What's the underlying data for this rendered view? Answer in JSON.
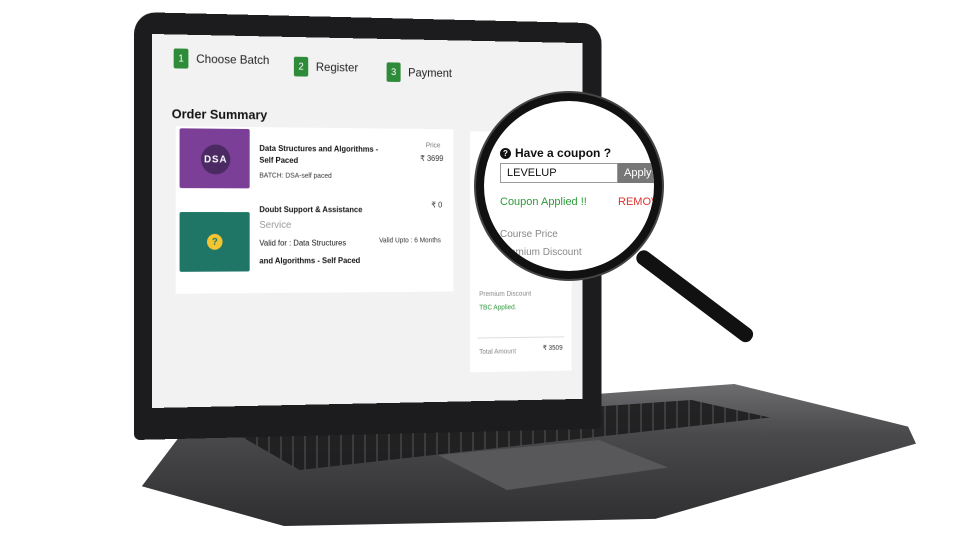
{
  "steps": [
    {
      "num": "1",
      "label": "Choose Batch"
    },
    {
      "num": "2",
      "label": "Register"
    },
    {
      "num": "3",
      "label": "Payment"
    }
  ],
  "order_summary": {
    "title": "Order Summary",
    "items": [
      {
        "thumb_text": "DSA",
        "title_line1": "Data Structures and Algorithms -",
        "title_line2": "Self Paced",
        "meta": "BATCH: DSA-self paced",
        "price_label": "Price",
        "price": "₹ 3699"
      },
      {
        "thumb_icon": "question-chat-icon",
        "thumb_text": "?",
        "title": "Doubt Support & Assistance",
        "subtitle": "Service",
        "valid_for_line1": "Valid for : Data Structures",
        "valid_for_line2": "and Algorithms - Self Paced",
        "valid_upto": "Valid Upto : 6 Months",
        "price": "₹ 0"
      }
    ]
  },
  "coupon": {
    "title": "Have a coupon ?",
    "code": "LEVELUP",
    "apply_label": "Apply",
    "applied_text": "Coupon Applied !!",
    "remove_label": "REMOVE"
  },
  "summary": {
    "course_price_label": "Course Price",
    "premium_discount_label": "Premium Discount",
    "tbc_text": "TBC Applied.",
    "total_label": "Total Amount",
    "total_value": "₹ 3509"
  },
  "colors": {
    "step_green": "#2e8b3a",
    "dsa_purple": "#7b3f98",
    "doubt_teal": "#1f7566",
    "success_green": "#2e9a3b",
    "remove_red": "#e0332f"
  }
}
